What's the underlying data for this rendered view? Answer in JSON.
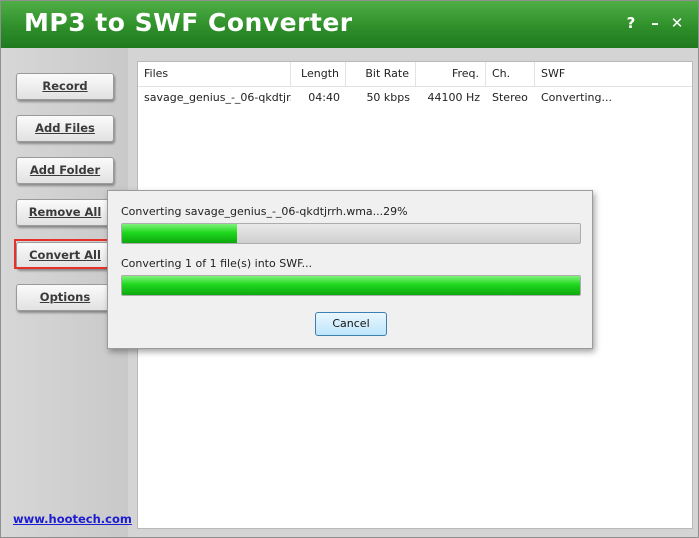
{
  "app": {
    "title": "MP3 to SWF Converter",
    "help": "?",
    "minimize": "–",
    "close": "✕"
  },
  "sidebar": {
    "buttons": [
      {
        "label": "Record"
      },
      {
        "label": "Add Files"
      },
      {
        "label": "Add Folder"
      },
      {
        "label": "Remove All"
      },
      {
        "label": "Convert All"
      },
      {
        "label": "Options"
      }
    ],
    "link": "www.hootech.com"
  },
  "list": {
    "columns": [
      "Files",
      "Length",
      "Bit Rate",
      "Freq.",
      "Ch.",
      "SWF"
    ],
    "rows": [
      {
        "file": "savage_genius_-_06-qkdtjr...",
        "length": "04:40",
        "bitrate": "50 kbps",
        "freq": "44100 Hz",
        "ch": "Stereo",
        "swf": "Converting..."
      }
    ]
  },
  "dialog": {
    "line1": "Converting savage_genius_-_06-qkdtjrrh.wma...29%",
    "progress1_fraction": 0.25,
    "line2": "Converting 1 of 1 file(s) into SWF...",
    "progress2_fraction": 1.0,
    "cancel": "Cancel"
  },
  "colors": {
    "title_green": "#2f8f2a",
    "progress_green": "#1fd81f",
    "highlight": "#e6312b"
  }
}
